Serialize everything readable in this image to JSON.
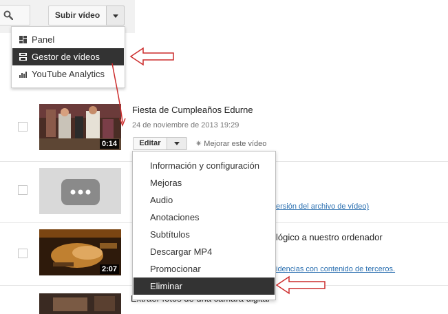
{
  "toolbar": {
    "upload_label": "Subir vídeo"
  },
  "top_menu": {
    "items": [
      {
        "label": "Panel",
        "icon": "dashboard-icon"
      },
      {
        "label": "Gestor de vídeos",
        "icon": "video-manager-icon",
        "active": true
      },
      {
        "label": "YouTube Analytics",
        "icon": "analytics-icon"
      }
    ]
  },
  "videos": [
    {
      "title": "Fiesta de Cumpleaños Edurne",
      "date": "24 de noviembre de 2013 19:29",
      "duration": "0:14",
      "edit_label": "Editar",
      "improve_label": "Mejorar este vídeo"
    },
    {
      "link_fragment": "ersión del archivo de vídeo)"
    },
    {
      "title_fragment": "lógico a nuestro ordenador",
      "link_fragment": "idencias con contenido de terceros.",
      "duration": "2:07"
    },
    {
      "title_fragment": "Extraer fotos de una cámara digital"
    }
  ],
  "edit_menu": {
    "items": [
      {
        "label": "Información y configuración"
      },
      {
        "label": "Mejoras"
      },
      {
        "label": "Audio"
      },
      {
        "label": "Anotaciones"
      },
      {
        "label": "Subtítulos"
      },
      {
        "label": "Descargar MP4"
      },
      {
        "label": "Promocionar"
      },
      {
        "label": "Eliminar",
        "active": true
      }
    ]
  },
  "colors": {
    "accent_dark": "#333333",
    "link": "#2a6fb0",
    "annotation_arrow": "#cc2b2b"
  }
}
